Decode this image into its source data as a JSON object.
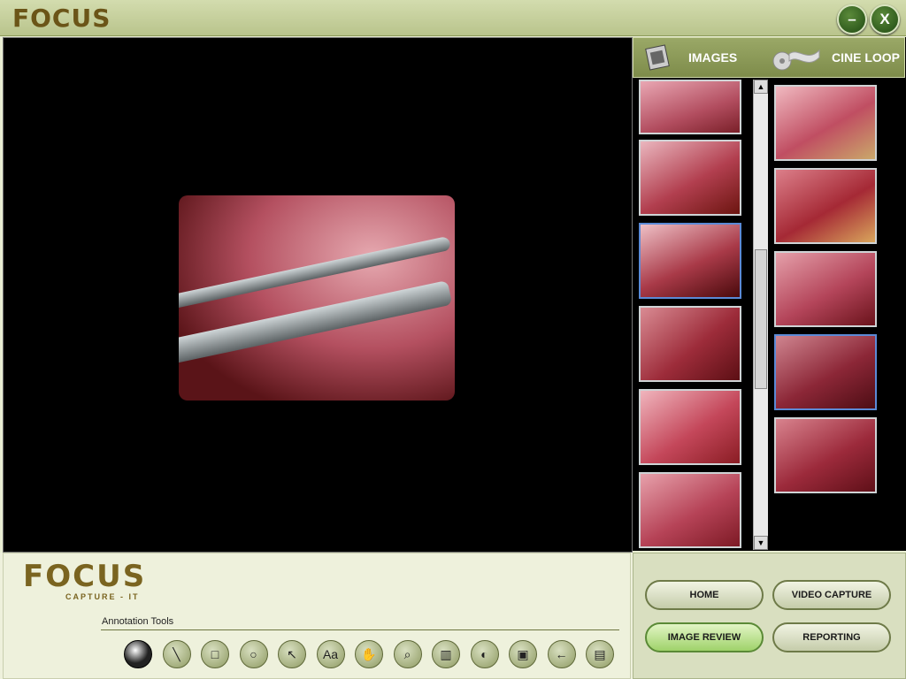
{
  "app": {
    "brand": "FOCUS",
    "minimize_label": "–",
    "close_label": "X"
  },
  "side": {
    "tabs": [
      {
        "label": "IMAGES",
        "icon": "film-icon"
      },
      {
        "label": "CINE LOOP",
        "icon": "cine-reel-icon"
      }
    ],
    "scroll_up": "▲",
    "scroll_down": "▼"
  },
  "bottom": {
    "logo_main": "FOCUS",
    "logo_sub": "CAPTURE - IT",
    "tools_label": "Annotation Tools",
    "tools": [
      {
        "name": "select-tool-icon",
        "glyph": ""
      },
      {
        "name": "line-tool-icon",
        "glyph": "╲"
      },
      {
        "name": "rectangle-tool-icon",
        "glyph": "□"
      },
      {
        "name": "circle-tool-icon",
        "glyph": "○"
      },
      {
        "name": "arrow-tool-icon",
        "glyph": "↖"
      },
      {
        "name": "text-tool-icon",
        "glyph": "Aa"
      },
      {
        "name": "hand-pan-icon",
        "glyph": "✋"
      },
      {
        "name": "zoom-tool-icon",
        "glyph": "⌕"
      },
      {
        "name": "measure-tool-icon",
        "glyph": "▥"
      },
      {
        "name": "contrast-tool-icon",
        "glyph": "◐"
      },
      {
        "name": "crop-tool-icon",
        "glyph": "▣"
      },
      {
        "name": "undo-back-icon",
        "glyph": "←"
      },
      {
        "name": "save-disk-icon",
        "glyph": "▤"
      }
    ]
  },
  "nav": {
    "home": "HOME",
    "video_capture": "VIDEO CAPTURE",
    "image_review": "IMAGE REVIEW",
    "reporting": "REPORTING"
  },
  "colors": {
    "brand": "#6b5518",
    "panel": "#eef1dc",
    "accent_green": "#9fd26a",
    "selected_border": "#5b8ad6"
  }
}
